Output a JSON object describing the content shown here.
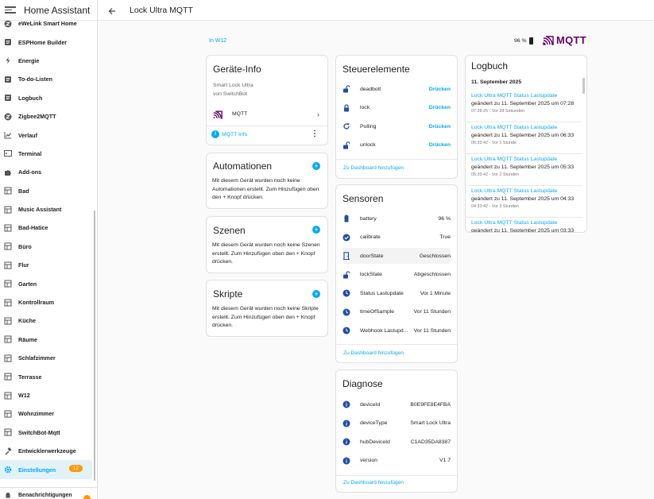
{
  "app": {
    "title": "Home Assistant"
  },
  "sidebar": {
    "items": [
      {
        "label": "eWeLink Smart Home",
        "icon": "ewelink-icon"
      },
      {
        "label": "ESPHome Builder",
        "icon": "esphome-icon"
      },
      {
        "label": "Energie",
        "icon": "lightning-icon"
      },
      {
        "label": "To-do-Listen",
        "icon": "todo-icon"
      },
      {
        "label": "Logbuch",
        "icon": "logbook-icon"
      },
      {
        "label": "Zigbee2MQTT",
        "icon": "zigbee-icon"
      },
      {
        "label": "Verlauf",
        "icon": "chart-icon"
      },
      {
        "label": "Terminal",
        "icon": "terminal-icon"
      },
      {
        "label": "Add-ons",
        "icon": "puzzle-icon"
      },
      {
        "label": "Bad",
        "icon": "dashboard-icon"
      },
      {
        "label": "Music Assistant",
        "icon": "dashboard-icon"
      },
      {
        "label": "Bad-Hatice",
        "icon": "dashboard-icon"
      },
      {
        "label": "Büro",
        "icon": "dashboard-icon"
      },
      {
        "label": "Flur",
        "icon": "dashboard-icon"
      },
      {
        "label": "Garten",
        "icon": "dashboard-icon"
      },
      {
        "label": "Kontrollraum",
        "icon": "dashboard-icon"
      },
      {
        "label": "Küche",
        "icon": "dashboard-icon"
      },
      {
        "label": "Räume",
        "icon": "dashboard-icon"
      },
      {
        "label": "Schlafzimmer",
        "icon": "dashboard-icon"
      },
      {
        "label": "Terrasse",
        "icon": "dashboard-icon"
      },
      {
        "label": "W12",
        "icon": "dashboard-icon"
      },
      {
        "label": "Wohnzimmer",
        "icon": "dashboard-icon"
      },
      {
        "label": "SwitchBot-Mqtt",
        "icon": "dashboard-icon"
      },
      {
        "label": "Entwicklerwerkzeuge",
        "icon": "hammer-icon"
      },
      {
        "label": "Einstellungen",
        "icon": "gear-icon",
        "badge": "12",
        "active": true
      }
    ],
    "bottom": {
      "label": "Benachrichtigungen",
      "icon": "bell-icon"
    }
  },
  "header": {
    "title": "Lock Ultra MQTT"
  },
  "area_link": "In W12",
  "battery": "96 %",
  "brand": {
    "name": "MQTT",
    "color": "#660066"
  },
  "device_info": {
    "title": "Geräte-Info",
    "model": "Smart Lock Ultra",
    "manufacturer": "von SwitchBot",
    "integration": "MQTT",
    "info_link": "MQTT Info"
  },
  "automations": {
    "title": "Automationen",
    "text": "Mit diesem Gerät wurden noch keine Automationen erstellt. Zum Hinzufügen oben den + Knopf drücken."
  },
  "scenes": {
    "title": "Szenen",
    "text": "Mit diesem Gerät wurden noch keine Szenen erstellt. Zum Hinzufügen oben den + Knopf drücken."
  },
  "scripts": {
    "title": "Skripte",
    "text": "Mit diesem Gerät wurden noch keine Skripte erstellt. Zum Hinzufügen oben den + Knopf drücken."
  },
  "controls": {
    "title": "Steuerelemente",
    "rows": [
      {
        "name": "deadbolt",
        "action": "Drücken",
        "icon": "lock-open-icon"
      },
      {
        "name": "lock",
        "action": "Drücken",
        "icon": "lock-icon"
      },
      {
        "name": "Polling",
        "action": "Drücken",
        "icon": "refresh-icon"
      },
      {
        "name": "unlock",
        "action": "Drücken",
        "icon": "lock-open-icon"
      }
    ],
    "footer": "Zu Dashboard hinzufügen"
  },
  "sensors": {
    "title": "Sensoren",
    "rows": [
      {
        "name": "battery",
        "value": "96 %",
        "icon": "battery-icon"
      },
      {
        "name": "calibrate",
        "value": "True",
        "icon": "check-circle-icon"
      },
      {
        "name": "doorState",
        "value": "Geschlossen",
        "icon": "door-icon"
      },
      {
        "name": "lockState",
        "value": "Abgeschlossen",
        "icon": "lock-open-icon"
      },
      {
        "name": "Status Lastupdate",
        "value": "Vor 1 Minute",
        "icon": "clock-icon"
      },
      {
        "name": "timeOfSample",
        "value": "Vor 11 Stunden",
        "icon": "clock-icon"
      },
      {
        "name": "Webhook Lastupd...",
        "value": "Vor 11 Stunden",
        "icon": "clock-icon"
      }
    ],
    "footer": "Zu Dashboard hinzufügen"
  },
  "diagnostics": {
    "title": "Diagnose",
    "rows": [
      {
        "name": "deviceId",
        "value": "B0E9FE8E4FBA",
        "icon": "info-icon"
      },
      {
        "name": "deviceType",
        "value": "Smart Lock Ultra",
        "icon": "info-icon"
      },
      {
        "name": "hubDeviceId",
        "value": "C1AD35DA8387",
        "icon": "info-icon"
      },
      {
        "name": "version",
        "value": "V1.7",
        "icon": "info-icon"
      }
    ],
    "footer": "Zu Dashboard hinzufügen"
  },
  "logbook": {
    "title": "Logbuch",
    "date": "11. September 2025",
    "entries": [
      {
        "title": "Lock Ultra MQTT Status Lastupdate",
        "detail": "geändert zu 11. September 2025 um 07:28",
        "time": "07:28:25 - Vor 28 Sekunden"
      },
      {
        "title": "Lock Ultra MQTT Status Lastupdate",
        "detail": "geändert zu 11. September 2025 um 06:33",
        "time": "06:33:42 - Vor 1 Stunde"
      },
      {
        "title": "Lock Ultra MQTT Status Lastupdate",
        "detail": "geändert zu 11. September 2025 um 05:33",
        "time": "05:33:42 - Vor 2 Stunden"
      },
      {
        "title": "Lock Ultra MQTT Status Lastupdate",
        "detail": "geändert zu 11. September 2025 um 04:33",
        "time": "04:33:42 - Vor 3 Stunden"
      },
      {
        "title": "Lock Ultra MQTT Status Lastupdate",
        "detail": "geändert zu 11. September 2025 um 03:33",
        "time": ""
      }
    ]
  },
  "colors": {
    "accent": "#03a9f4",
    "icon": "#1e4fa3",
    "badge": "#ff9800"
  }
}
